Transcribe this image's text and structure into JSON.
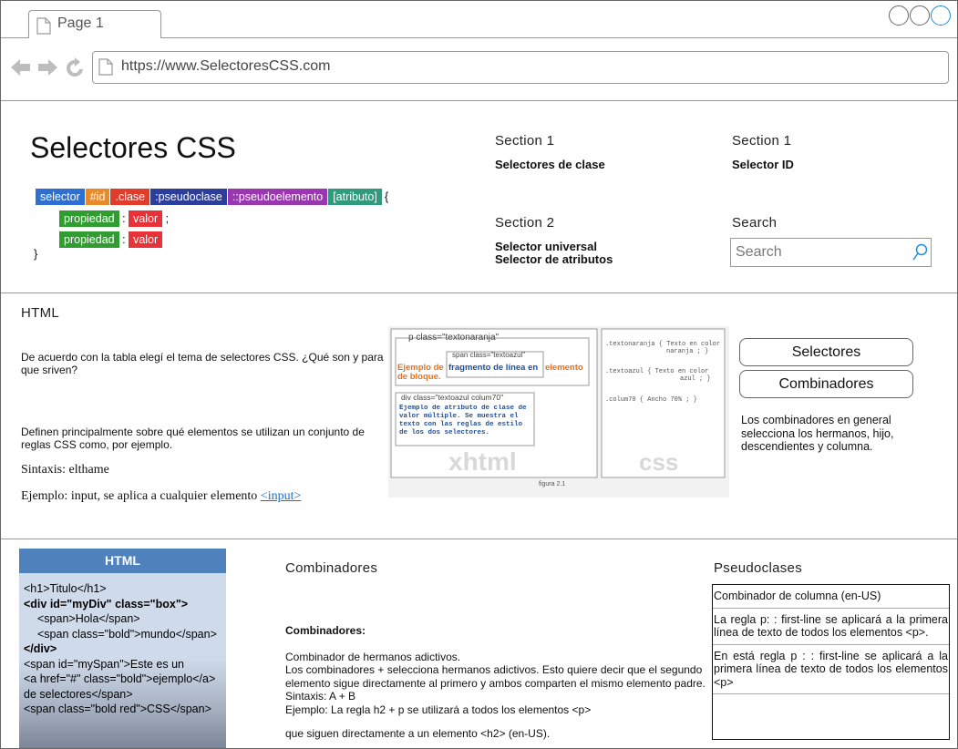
{
  "browser": {
    "tab_title": "Page 1",
    "url": "https://www.SelectoresCSS.com"
  },
  "header": {
    "title": "Selectores CSS",
    "syntax": {
      "chips": [
        {
          "text": "selector",
          "color": "#2f6fd0"
        },
        {
          "text": "#id",
          "color": "#e8892c"
        },
        {
          "text": ".clase",
          "color": "#e03c2c"
        },
        {
          "text": ":pseudoclase",
          "color": "#2d3e9a"
        },
        {
          "text": "::pseudoelemento",
          "color": "#9a36b0"
        },
        {
          "text": "[atributo]",
          "color": "#2f9a7c"
        }
      ],
      "open_brace": "{",
      "property": "propiedad",
      "value": "valor",
      "colon": ":",
      "semicolon": ";",
      "close_brace": "}",
      "property_color": "#2f9d2f",
      "value_color": "#e8323a"
    },
    "sections": [
      {
        "title": "Section 1",
        "links": [
          "Selectores de clase"
        ]
      },
      {
        "title": "Section 1",
        "links": [
          "Selector ID"
        ]
      },
      {
        "title": "Section 2",
        "links": [
          "Selector universal",
          "Selector de atributos"
        ]
      }
    ],
    "search": {
      "title": "Search",
      "placeholder": "Search"
    }
  },
  "html_section": {
    "title": "HTML",
    "question": "De acuerdo con la tabla elegí el tema de selectores CSS. ¿Qué son y para que sriven?",
    "definition": "Definen principalmente sobre qué elementos se utilizan un conjunto de reglas CSS como, por ejemplo.",
    "syntax": "Sintaxis: elthame",
    "example_prefix": "Ejemplo: input, se aplica a cualquier elemento ",
    "example_link": "<input>",
    "figure": {
      "p_label": "p class=\"textonaranja\"",
      "span_label": "span class=\"textoazul\"",
      "text_before": "Ejemplo de",
      "text_span": "fragmento de línea en",
      "text_after": "elemento",
      "text_line2": "de bloque.",
      "div_label": "div class=\"textoazul colum70\"",
      "div_text": "Ejemplo de atributo de clase de valor múltiple. Se muestra el texto con las reglas de estilo de los dos selectores.",
      "xhtml_label": "xhtml",
      "css_label": "css",
      "css_rule1a": ".textonaranja  { Texto en color",
      "css_rule1b": "naranja ; }",
      "css_rule2a": ".textoazul  { Texto en color",
      "css_rule2b": "azul ; }",
      "css_rule3": ".colum70 { Ancho 70% ; }",
      "caption": "figura 2.1"
    },
    "buttons": [
      "Selectores",
      "Combinadores"
    ],
    "description": "Los combinadores en general selecciona los hermanos, hijo, descendientes y columna."
  },
  "bottom": {
    "code": {
      "header": "HTML",
      "lines": [
        "<h1>Titulo</h1>",
        "<div id=\"myDiv\" class=\"box\">",
        "<span>Hola</span>",
        "<span class=\"bold\">mundo</span>",
        "</div>",
        "<span id=\"mySpan\">Este es un",
        "<a href=\"#\" class=\"bold\">ejemplo</a>",
        "de selectores</span>",
        "<span class=\"bold red\">CSS</span>"
      ]
    },
    "combinadores": {
      "title": "Combinadores",
      "heading": "Combinadores:",
      "lines": [
        "Combinador de hermanos adictivos.",
        "Los combinadores + selecciona hermanos adictivos. Esto quiere decir que el segundo elemento sigue directamente al primero y ambos comparten el mismo elemento padre.",
        "Sintaxis: A + B",
        "Ejemplo: La regla h2 + p se utilizará a todos los elementos <p>"
      ],
      "last_line": "que siguen directamente a un elemento <h2> (en-US)."
    },
    "pseudoclases": {
      "title": "Pseudoclases",
      "rows": [
        "Combinador de columna (en-US)",
        "La regla p: : first-line se aplicará a la primera línea de texto de todos los elementos <p>.",
        "En está regla p : : first-line se aplicará a la primera línea de texto de todos los elementos <p>",
        ""
      ]
    }
  }
}
